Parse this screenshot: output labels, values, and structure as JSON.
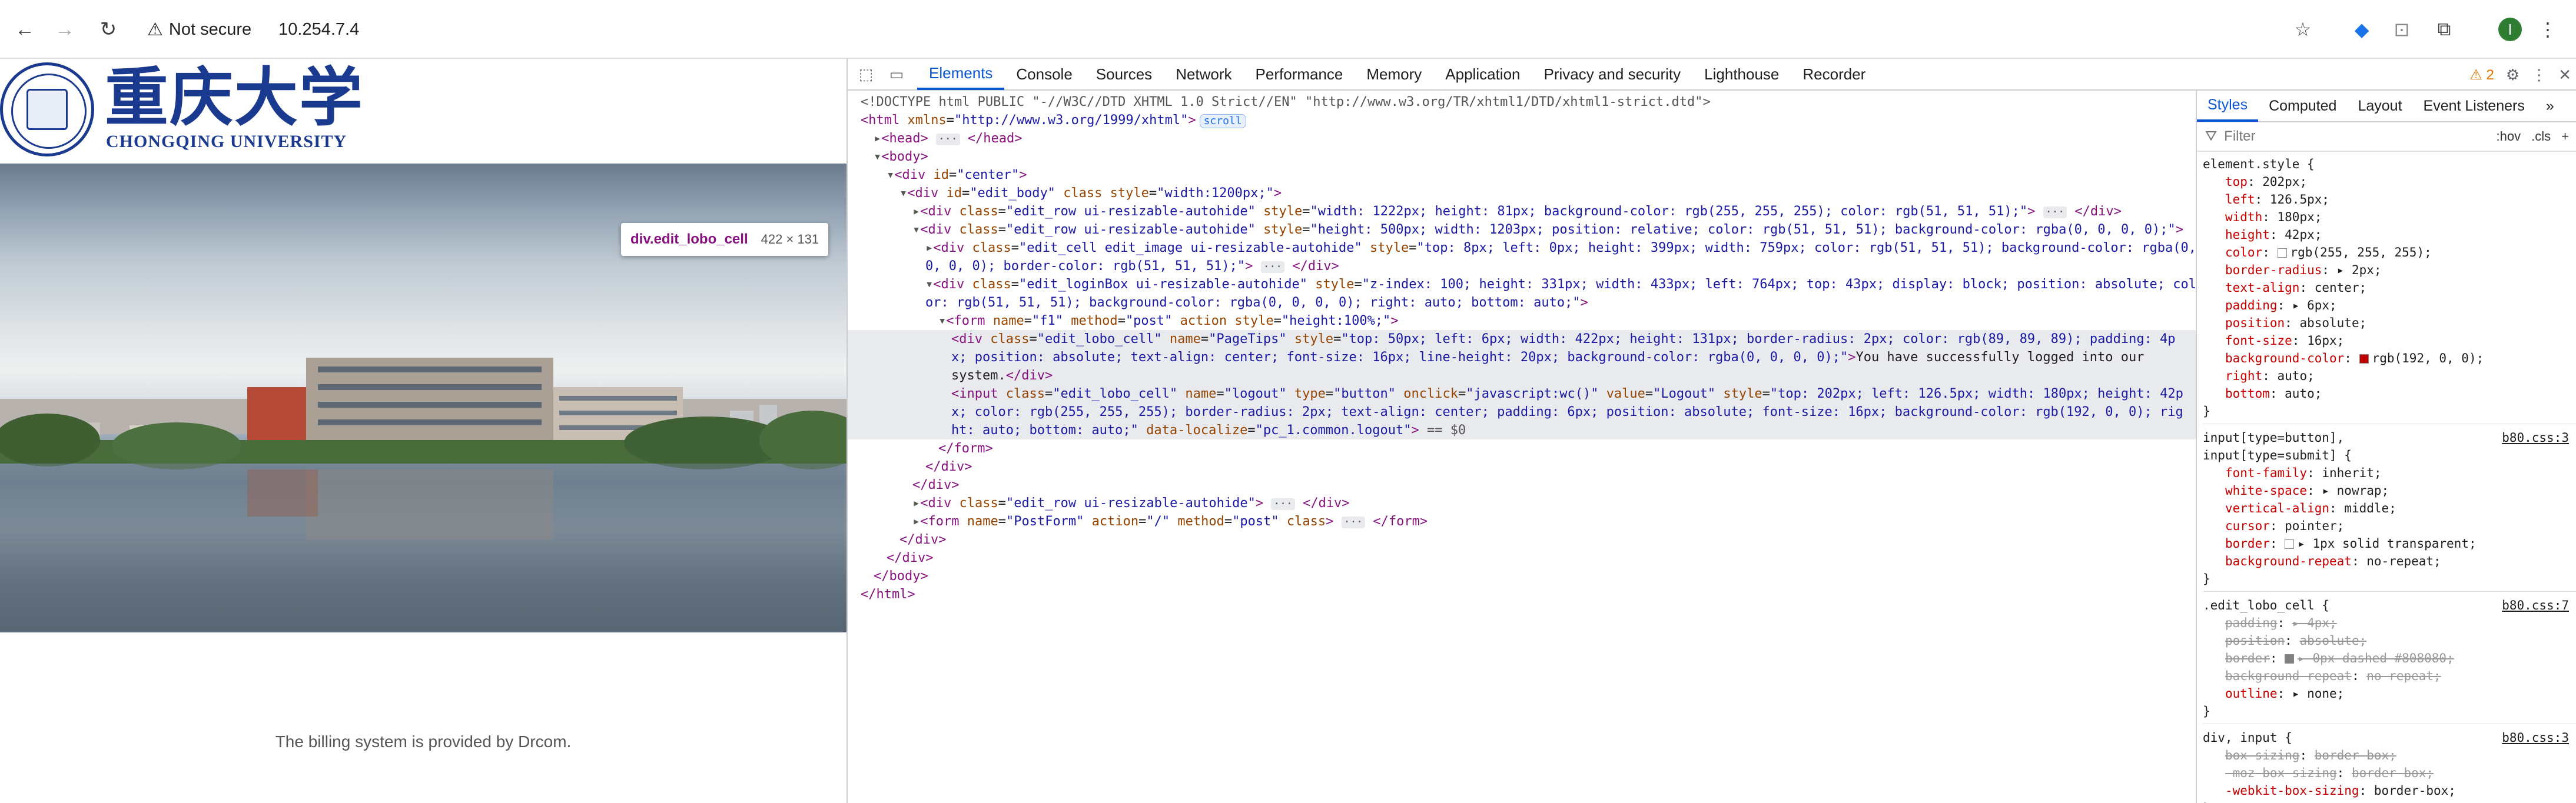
{
  "browser": {
    "security_label": "Not secure",
    "url": "10.254.7.4",
    "avatar_letter": "I"
  },
  "page": {
    "logo_cn": "重庆大学",
    "logo_en": "CHONGQING UNIVERSITY",
    "tooltip_name": "div.edit_lobo_cell",
    "tooltip_size": "422 × 131",
    "footer": "The billing system is provided by Drcom."
  },
  "devtools": {
    "tabs": [
      "Elements",
      "Console",
      "Sources",
      "Network",
      "Performance",
      "Memory",
      "Application",
      "Privacy and security",
      "Lighthouse",
      "Recorder"
    ],
    "warning_count": "2",
    "styles_tabs": [
      "Styles",
      "Computed",
      "Layout",
      "Event Listeners"
    ],
    "filter_placeholder": "Filter",
    "filter_tools": [
      ":hov",
      ".cls",
      "+"
    ],
    "dom_lines": [
      {
        "indent": 0,
        "html": "<span class='cm'>&lt;!DOCTYPE html PUBLIC \"-//W3C//DTD XHTML 1.0 Strict//EN\" \"http://www.w3.org/TR/xhtml1/DTD/xhtml1-strict.dtd\"&gt;</span>"
      },
      {
        "indent": 0,
        "html": "<span class='tg'>&lt;html</span> <span class='at'>xmlns</span>=<span class='av'>\"http://www.w3.org/1999/xhtml\"</span><span class='tg'>&gt;</span><span class='pill'>scroll</span>"
      },
      {
        "indent": 1,
        "html": "<span class='tri'>▸</span><span class='tg'>&lt;head&gt;</span> <span class='ell'>···</span> <span class='tg'>&lt;/head&gt;</span>"
      },
      {
        "indent": 1,
        "html": "<span class='tri'>▾</span><span class='tg'>&lt;body&gt;</span>"
      },
      {
        "indent": 2,
        "html": "<span class='tri'>▾</span><span class='tg'>&lt;div</span> <span class='at'>id</span>=<span class='av'>\"center\"</span><span class='tg'>&gt;</span>"
      },
      {
        "indent": 3,
        "html": "<span class='tri'>▾</span><span class='tg'>&lt;div</span> <span class='at'>id</span>=<span class='av'>\"edit_body\"</span> <span class='at'>class style</span>=<span class='av'>\"width:1200px;\"</span><span class='tg'>&gt;</span>"
      },
      {
        "indent": 4,
        "html": "<span class='tri'>▸</span><span class='tg'>&lt;div</span> <span class='at'>class</span>=<span class='av'>\"edit_row ui-resizable-autohide\"</span> <span class='at'>style</span>=<span class='av'>\"width: 1222px; height: 81px; background-color: rgb(255, 255, 255); color: rgb(51, 51, 51);\"</span><span class='tg'>&gt;</span> <span class='ell'>···</span> <span class='tg'>&lt;/div&gt;</span>"
      },
      {
        "indent": 4,
        "html": "<span class='tri'>▾</span><span class='tg'>&lt;div</span> <span class='at'>class</span>=<span class='av'>\"edit_row ui-resizable-autohide\"</span> <span class='at'>style</span>=<span class='av'>\"height: 500px; width: 1203px; position: relative; color: rgb(51, 51, 51); background-color: rgba(0, 0, 0, 0);\"</span><span class='tg'>&gt;</span>"
      },
      {
        "indent": 5,
        "html": "<span class='tri'>▸</span><span class='tg'>&lt;div</span> <span class='at'>class</span>=<span class='av'>\"edit_cell edit_image ui-resizable-autohide\"</span> <span class='at'>style</span>=<span class='av'>\"top: 8px; left: 0px; height: 399px; width: 759px; color: rgb(51, 51, 51); background-color: rgba(0,</span>"
      },
      {
        "indent": 5,
        "html": "<span class='av'>0, 0, 0); border-color: rgb(51, 51, 51);\"</span><span class='tg'>&gt;</span> <span class='ell'>···</span> <span class='tg'>&lt;/div&gt;</span>"
      },
      {
        "indent": 5,
        "html": "<span class='tri'>▾</span><span class='tg'>&lt;div</span> <span class='at'>class</span>=<span class='av'>\"edit_loginBox ui-resizable-autohide\"</span> <span class='at'>style</span>=<span class='av'>\"z-index: 100; height: 331px; width: 433px; left: 764px; top: 43px; display: block; position: absolute; col</span>"
      },
      {
        "indent": 5,
        "html": "<span class='av'>or: rgb(51, 51, 51); background-color: rgba(0, 0, 0, 0); right: auto; bottom: auto;\"</span><span class='tg'>&gt;</span>"
      },
      {
        "indent": 6,
        "html": "<span class='tri'>▾</span><span class='tg'>&lt;form</span> <span class='at'>name</span>=<span class='av'>\"f1\"</span> <span class='at'>method</span>=<span class='av'>\"post\"</span> <span class='at'>action style</span>=<span class='av'>\"height:100%;\"</span><span class='tg'>&gt;</span>"
      },
      {
        "indent": 7,
        "sel": true,
        "html": "<span class='tg'>&lt;div</span> <span class='at'>class</span>=<span class='av'>\"edit_lobo_cell\"</span> <span class='at'>name</span>=<span class='av'>\"PageTips\"</span> <span class='at'>style</span>=<span class='av'>\"top: 50px; left: 6px; width: 422px; height: 131px; border-radius: 2px; color: rgb(89, 89, 89); padding: 4p</span>"
      },
      {
        "indent": 7,
        "sel": true,
        "html": "<span class='av'>x; position: absolute; text-align: center; font-size: 16px; line-height: 20px; background-color: rgba(0, 0, 0, 0);\"</span><span class='tg'>&gt;</span><span class='tx'>You have successfully logged into our</span>"
      },
      {
        "indent": 7,
        "sel": true,
        "html": "<span class='tx'>system.</span><span class='tg'>&lt;/div&gt;</span>"
      },
      {
        "indent": 7,
        "sel": true,
        "html": "<span class='tg'>&lt;input</span> <span class='at'>class</span>=<span class='av'>\"edit_lobo_cell\"</span> <span class='at'>name</span>=<span class='av'>\"logout\"</span> <span class='at'>type</span>=<span class='av'>\"button\"</span> <span class='at'>onclick</span>=<span class='av'>\"javascript:wc()\"</span> <span class='at'>value</span>=<span class='av'>\"Logout\"</span> <span class='at'>style</span>=<span class='av'>\"top: 202px; left: 126.5px; width: 180px; height: 42p</span>"
      },
      {
        "indent": 7,
        "sel": true,
        "html": "<span class='av'>x; color: rgb(255, 255, 255); border-radius: 2px; text-align: center; padding: 6px; position: absolute; font-size: 16px; background-color: rgb(192, 0, 0); rig</span>"
      },
      {
        "indent": 7,
        "sel": true,
        "html": "<span class='av'>ht: auto; bottom: auto;\"</span> <span class='at'>data-localize</span>=<span class='av'>\"pc_1.common.logout\"</span><span class='tg'>&gt;</span> <span class='cm'>== $0</span>"
      },
      {
        "indent": 6,
        "html": "<span class='tg'>&lt;/form&gt;</span>"
      },
      {
        "indent": 5,
        "html": "<span class='tg'>&lt;/div&gt;</span>"
      },
      {
        "indent": 4,
        "html": "<span class='tg'>&lt;/div&gt;</span>"
      },
      {
        "indent": 4,
        "html": "<span class='tri'>▸</span><span class='tg'>&lt;div</span> <span class='at'>class</span>=<span class='av'>\"edit_row ui-resizable-autohide\"</span><span class='tg'>&gt;</span> <span class='ell'>···</span> <span class='tg'>&lt;/div&gt;</span>"
      },
      {
        "indent": 4,
        "html": "<span class='tri'>▸</span><span class='tg'>&lt;form</span> <span class='at'>name</span>=<span class='av'>\"PostForm\"</span> <span class='at'>action</span>=<span class='av'>\"/\"</span> <span class='at'>method</span>=<span class='av'>\"post\"</span> <span class='at'>class</span><span class='tg'>&gt;</span> <span class='ell'>···</span> <span class='tg'>&lt;/form&gt;</span>"
      },
      {
        "indent": 3,
        "html": "<span class='tg'>&lt;/div&gt;</span>"
      },
      {
        "indent": 2,
        "html": "<span class='tg'>&lt;/div&gt;</span>"
      },
      {
        "indent": 1,
        "html": "<span class='tg'>&lt;/body&gt;</span>"
      },
      {
        "indent": 0,
        "html": "<span class='tg'>&lt;/html&gt;</span>"
      }
    ],
    "style_rules": [
      {
        "selector": "element.style {",
        "source": "",
        "props": [
          {
            "n": "top",
            "v": "202px;"
          },
          {
            "n": "left",
            "v": "126.5px;"
          },
          {
            "n": "width",
            "v": "180px;"
          },
          {
            "n": "height",
            "v": "42px;"
          },
          {
            "n": "color",
            "v": "rgb(255, 255, 255);",
            "swatch": "#ffffff"
          },
          {
            "n": "border-radius",
            "v": "▸ 2px;"
          },
          {
            "n": "text-align",
            "v": "center;"
          },
          {
            "n": "padding",
            "v": "▸ 6px;"
          },
          {
            "n": "position",
            "v": "absolute;"
          },
          {
            "n": "font-size",
            "v": "16px;"
          },
          {
            "n": "background-color",
            "v": "rgb(192, 0, 0);",
            "swatch": "#c00000"
          },
          {
            "n": "right",
            "v": "auto;"
          },
          {
            "n": "bottom",
            "v": "auto;"
          }
        ]
      },
      {
        "selector": "input[type=button],\ninput[type=submit] {",
        "source": "b80.css:3",
        "props": [
          {
            "n": "font-family",
            "v": "inherit;"
          },
          {
            "n": "white-space",
            "v": "▸ nowrap;"
          },
          {
            "n": "vertical-align",
            "v": "middle;"
          },
          {
            "n": "cursor",
            "v": "pointer;"
          },
          {
            "n": "border",
            "v": "▸ 1px solid transparent;",
            "swatch": "#ffffff"
          },
          {
            "n": "background-repeat",
            "v": "no-repeat;"
          }
        ]
      },
      {
        "selector": ".edit_lobo_cell {",
        "source": "b80.css:7",
        "props": [
          {
            "n": "padding",
            "v": "▸ 4px;",
            "strike": true
          },
          {
            "n": "position",
            "v": "absolute;",
            "strike": true
          },
          {
            "n": "border",
            "v": "▸ 0px dashed #808080;",
            "strike": true,
            "swatch": "#808080"
          },
          {
            "n": "background-repeat",
            "v": "no-repeat;",
            "strike": true
          },
          {
            "n": "outline",
            "v": "▸ none;"
          }
        ]
      },
      {
        "selector": "div, input {",
        "source": "b80.css:3",
        "props": [
          {
            "n": "box-sizing",
            "v": "border-box;",
            "strike": true
          },
          {
            "n": "-moz-box-sizing",
            "v": "border-box;",
            "strike": true
          },
          {
            "n": "-webkit-box-sizing",
            "v": "border-box;"
          }
        ]
      }
    ]
  }
}
